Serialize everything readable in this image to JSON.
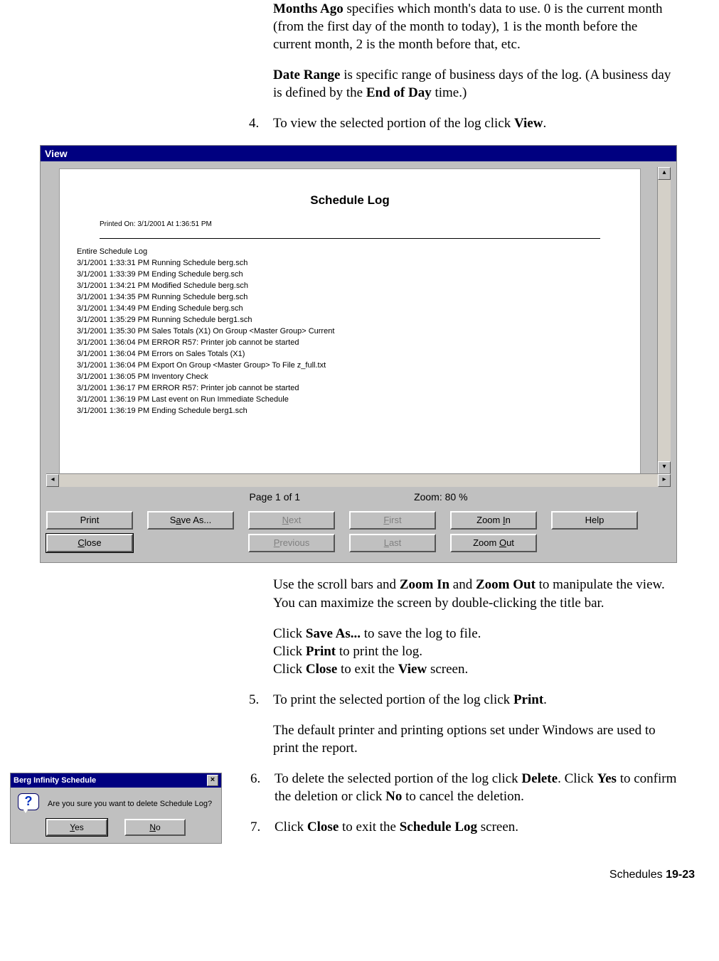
{
  "intro": {
    "months_b": "Months Ago",
    "months_t": " specifies which month's data to use. 0 is the current month (from the first day of the month to today), 1 is the month before the current month, 2 is the month before that, etc.",
    "dr_b": "Date Range",
    "dr_t1": " is specific range of business days of the log. (A business day is defined by the ",
    "dr_b2": "End of Day",
    "dr_t2": " time.)"
  },
  "step4": {
    "num": "4.",
    "pre": "To view the selected portion of the log click ",
    "b": "View",
    "post": "."
  },
  "view": {
    "title": "View",
    "doc_title": "Schedule Log",
    "printed": "Printed On: 3/1/2001 At 1:36:51 PM",
    "entire": "Entire Schedule Log",
    "lines": [
      "3/1/2001 1:33:31 PM Running Schedule berg.sch",
      "3/1/2001 1:33:39 PM Ending Schedule berg.sch",
      "3/1/2001 1:34:21 PM Modified Schedule berg.sch",
      "3/1/2001 1:34:35 PM Running Schedule berg.sch",
      "3/1/2001 1:34:49 PM Ending Schedule berg.sch",
      "3/1/2001 1:35:29 PM Running Schedule berg1.sch",
      "3/1/2001 1:35:30 PM Sales Totals (X1) On Group <Master Group> Current",
      "3/1/2001 1:36:04 PM ERROR R57: Printer job cannot be started",
      "3/1/2001 1:36:04 PM Errors on Sales Totals (X1)",
      "3/1/2001 1:36:04 PM Export On Group <Master Group> To File z_full.txt",
      "3/1/2001 1:36:05 PM Inventory Check",
      "3/1/2001 1:36:17 PM ERROR R57: Printer job cannot be started",
      "3/1/2001 1:36:19 PM Last event on Run Immediate Schedule",
      "3/1/2001 1:36:19 PM Ending Schedule berg1.sch"
    ],
    "page": "Page 1 of 1",
    "zoom": "Zoom: 80 %",
    "btns": {
      "print": "Print",
      "saveas_pre": "S",
      "saveas_u": "a",
      "saveas_post": "ve As...",
      "next_u": "N",
      "next_post": "ext",
      "first_u": "F",
      "first_post": "irst",
      "zin_pre": "Zoom ",
      "zin_u": "I",
      "zin_post": "n",
      "help": "Help",
      "close_u": "C",
      "close_post": "lose",
      "prev_u": "P",
      "prev_post": "revious",
      "last_u": "L",
      "last_post": "ast",
      "zout_pre": "Zoom ",
      "zout_u": "O",
      "zout_post": "ut"
    }
  },
  "after_view": {
    "p1_pre": "Use the scroll bars and ",
    "p1_b1": "Zoom In",
    "p1_mid": " and ",
    "p1_b2": "Zoom Out",
    "p1_post": " to manipulate the view. You can maximize the screen by double-clicking the title bar.",
    "p2a_pre": "Click ",
    "p2a_b": "Save As...",
    "p2a_post": " to save the log to file.",
    "p2b_pre": "Click ",
    "p2b_b": "Print",
    "p2b_post": " to print the log.",
    "p2c_pre": "Click ",
    "p2c_b": "Close",
    "p2c_mid": " to exit the ",
    "p2c_b2": "View",
    "p2c_post": " screen."
  },
  "step5": {
    "num": "5.",
    "pre": "To print the selected portion of the log click ",
    "b": "Print",
    "post": ".",
    "sub": "The default printer and printing options set under Windows are used to print the report."
  },
  "confirm": {
    "title": "Berg Infinity Schedule",
    "msg": "Are you sure you want to delete Schedule Log?",
    "yes_u": "Y",
    "yes_post": "es",
    "no_u": "N",
    "no_post": "o"
  },
  "step6": {
    "num": "6.",
    "pre": "To delete the selected portion of the log click ",
    "b1": "Delete",
    "mid1": ". Click ",
    "b2": "Yes",
    "mid2": " to confirm the deletion or click ",
    "b3": "No",
    "post": " to cancel the deletion."
  },
  "step7": {
    "num": "7.",
    "pre": "Click ",
    "b1": "Close",
    "mid": " to exit the ",
    "b2": "Schedule Log",
    "post": " screen."
  },
  "footer": {
    "label": "Schedules  ",
    "page": "19-23"
  }
}
